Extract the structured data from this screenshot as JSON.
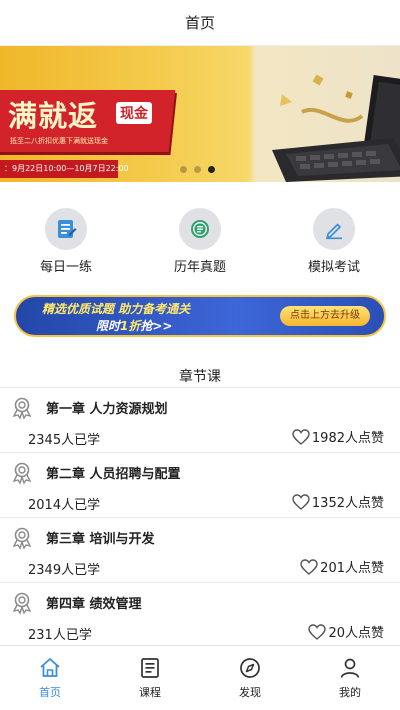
{
  "header": {
    "title": "首页"
  },
  "banner": {
    "headline": "满就返",
    "tag": "现金",
    "subline": "抵至二八折扣优惠下满就送现金",
    "date": "：9月22日10:00—10月7日22:00",
    "slide_index": 3,
    "slide_count": 3
  },
  "quick_actions": [
    {
      "label": "每日一练",
      "icon": "practice-icon"
    },
    {
      "label": "历年真题",
      "icon": "past-exams-icon"
    },
    {
      "label": "模拟考试",
      "icon": "mock-exam-icon"
    }
  ],
  "promo": {
    "line1": "精选优质试题 助力备考通关",
    "line2_prefix": "限时",
    "line2_highlight": "1折",
    "line2_suffix": "抢>>",
    "cta": "点击上方去升级"
  },
  "section": {
    "title": "章节课"
  },
  "courses": [
    {
      "title": "第一章 人力资源规划",
      "learners": "2345人已学",
      "likes": "1982人点赞"
    },
    {
      "title": "第二章 人员招聘与配置",
      "learners": "2014人已学",
      "likes": "1352人点赞"
    },
    {
      "title": "第三章 培训与开发",
      "learners": "2349人已学",
      "likes": "201人点赞"
    },
    {
      "title": "第四章 绩效管理",
      "learners": "231人已学",
      "likes": "20人点赞"
    }
  ],
  "tabbar": {
    "active_color": "#3b8ed8",
    "items": [
      {
        "label": "首页",
        "icon": "home-icon"
      },
      {
        "label": "课程",
        "icon": "course-icon"
      },
      {
        "label": "发现",
        "icon": "compass-icon"
      },
      {
        "label": "我的",
        "icon": "profile-icon"
      }
    ]
  }
}
